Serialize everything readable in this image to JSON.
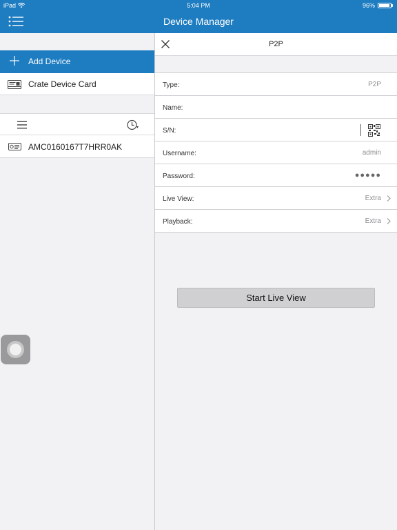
{
  "status_bar": {
    "carrier": "iPad",
    "time": "5:04 PM",
    "battery": "96%",
    "battery_level": 0.96
  },
  "header": {
    "title": "Device Manager",
    "menu_icon": "list-menu-icon"
  },
  "sidebar": {
    "add_device_label": "Add Device",
    "create_card_label": "Crate Device Card",
    "device_name": "AMC0160167T7HRR0AK"
  },
  "detail": {
    "title": "P2P",
    "fields": {
      "type": {
        "label": "Type:",
        "value": "P2P"
      },
      "name": {
        "label": "Name:",
        "value": ""
      },
      "sn": {
        "label": "S/N:",
        "value": ""
      },
      "username": {
        "label": "Username:",
        "value": "admin"
      },
      "password": {
        "label": "Password:",
        "value": "●●●●●"
      },
      "live_view": {
        "label": "Live View:",
        "value": "Extra"
      },
      "playback": {
        "label": "Playback:",
        "value": "Extra"
      }
    },
    "start_button": "Start Live View"
  },
  "colors": {
    "accent": "#1e7cc1",
    "background": "#f2f2f4",
    "button": "#d0d0d2"
  }
}
